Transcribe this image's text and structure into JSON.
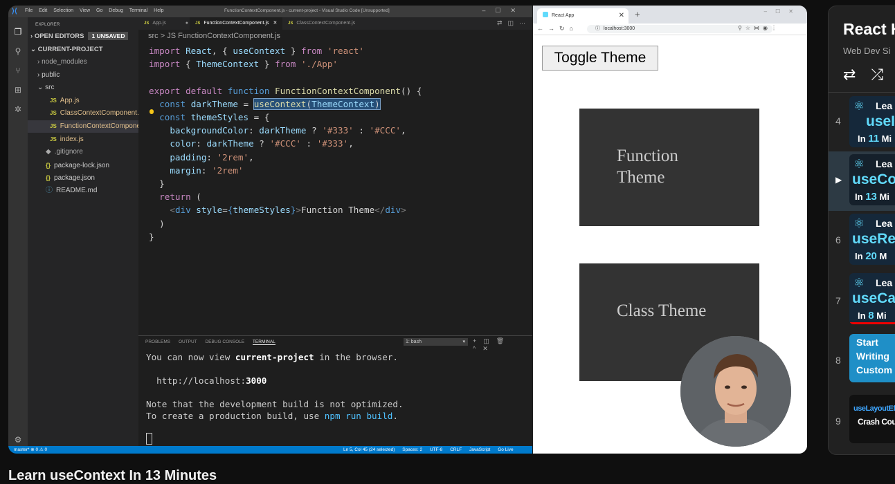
{
  "vscode": {
    "menu": [
      "File",
      "Edit",
      "Selection",
      "View",
      "Go",
      "Debug",
      "Terminal",
      "Help"
    ],
    "window_title": "FunctionContextComponent.js - current-project - Visual Studio Code [Unsupported]",
    "explorer_label": "EXPLORER",
    "open_editors": "OPEN EDITORS",
    "unsaved_badge": "1 UNSAVED",
    "project": "CURRENT-PROJECT",
    "tree": [
      "node_modules",
      "public",
      "src",
      "App.js",
      "ClassContextComponent.js",
      "FunctionContextComponent.js",
      "index.js",
      ".gitignore",
      "package-lock.json",
      "package.json",
      "README.md"
    ],
    "tabs": [
      "App.js",
      "FunctionContextComponent.js",
      "ClassContextComponent.js"
    ],
    "breadcrumb": "src > JS FunctionContextComponent.js",
    "panel_tabs": [
      "PROBLEMS",
      "OUTPUT",
      "DEBUG CONSOLE",
      "TERMINAL"
    ],
    "terminal_select": "1: bash",
    "terminal_lines": [
      "You can now view current-project in the browser.",
      "http://localhost:3000",
      "Note that the development build is not optimized.",
      "To create a production build, use npm run build."
    ],
    "status_left": "master*   ⊗ 0 ⚠ 0",
    "status_right": [
      "Ln 5, Col 45 (24 selected)",
      "Spaces: 2",
      "UTF-8",
      "CRLF",
      "JavaScript",
      "Go Live"
    ]
  },
  "browser": {
    "tab_title": "React App",
    "url": "localhost:3000",
    "toggle_button": "Toggle Theme",
    "function_theme": "Function Theme",
    "class_theme": "Class Theme"
  },
  "playlist": {
    "title": "React H",
    "subtitle": "Web Dev Si",
    "items": [
      {
        "num": "4",
        "t1": "Lea",
        "t2": "useI",
        "t3a": "In",
        "t3b": "11",
        "t3c": "Mi"
      },
      {
        "num": "▶",
        "t1": "Lea",
        "t2": "useCo",
        "t3a": "In",
        "t3b": "13",
        "t3c": "Mi"
      },
      {
        "num": "6",
        "t1": "Lea",
        "t2": "useRe",
        "t3a": "In",
        "t3b": "20",
        "t3c": "M"
      },
      {
        "num": "7",
        "t1": "Lea",
        "t2": "useCal",
        "t3a": "In",
        "t3b": "8",
        "t3c": "Mi"
      },
      {
        "num": "8",
        "t1": "Start",
        "t2": "Writing",
        "t3a": "Custom",
        "t3b": "",
        "t3c": ""
      },
      {
        "num": "9",
        "t1": "useLayoutEff",
        "t2": "Crash Cours",
        "t3a": "",
        "t3b": "",
        "t3c": ""
      }
    ]
  },
  "video_title": "Learn useContext In 13 Minutes"
}
